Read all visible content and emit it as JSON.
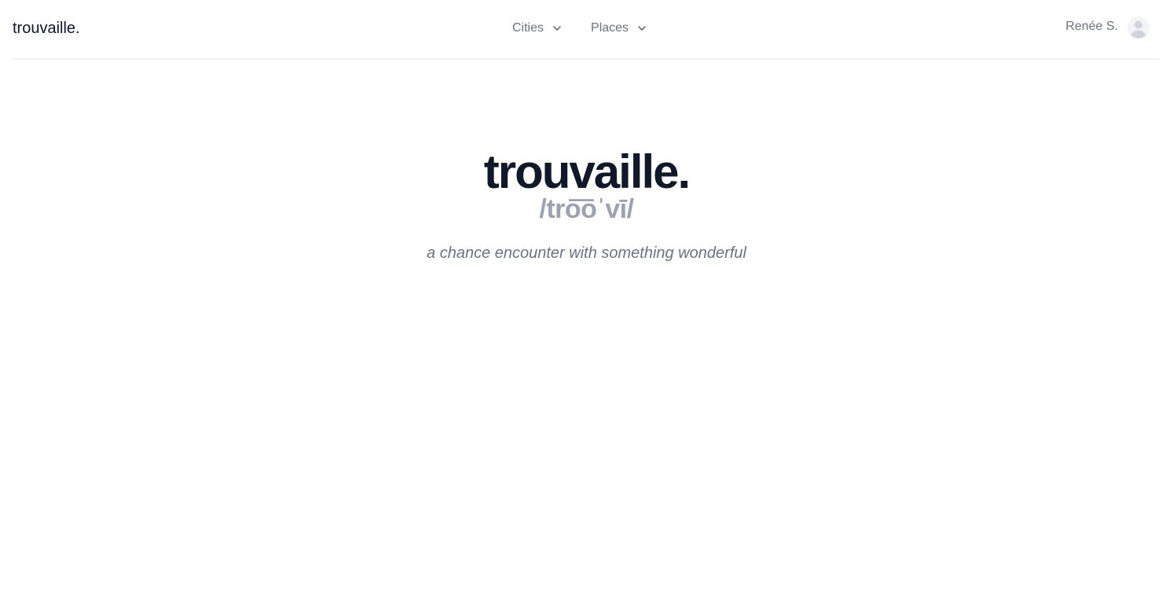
{
  "header": {
    "brand": "trouvaille.",
    "nav": [
      {
        "label": "Cities",
        "icon": "chevron-down-icon"
      },
      {
        "label": "Places",
        "icon": "chevron-down-icon"
      }
    ],
    "user": {
      "name": "Renée S.",
      "avatar_icon": "user-avatar-icon"
    }
  },
  "hero": {
    "title": "trouvaille.",
    "pronunciation": "/tro͞oˈvī/",
    "definition": "a chance encounter with something wonderful"
  },
  "colors": {
    "text_primary": "#111827",
    "text_secondary": "#6b7280",
    "text_muted": "#9ca3af",
    "divider": "#f1f3f5",
    "avatar_bg": "#f3f4f6"
  }
}
